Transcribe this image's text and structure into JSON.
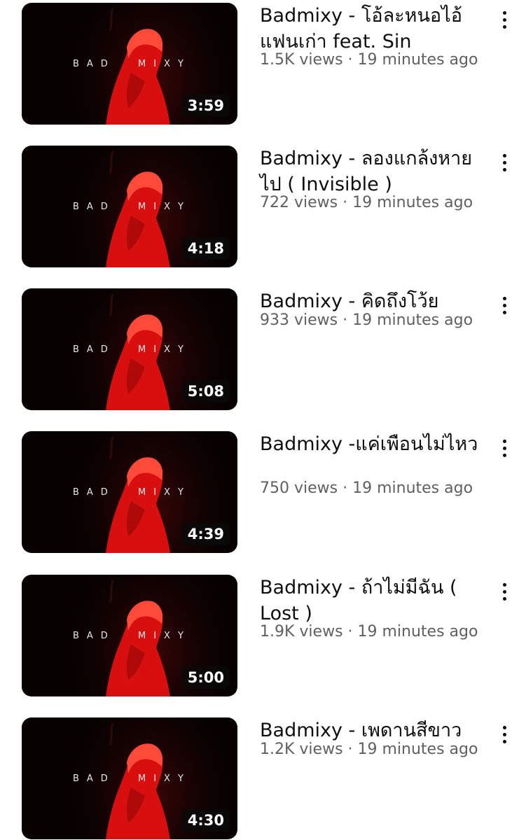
{
  "brand_text_left": "BAD",
  "brand_text_right": "MIXY",
  "videos": [
    {
      "title": "Badmixy -  โอ้ละหนอไอ้แฟนเก่า feat.  Sin",
      "views": "1.5K views",
      "age": "19 minutes ago",
      "duration": "3:59"
    },
    {
      "title": "Badmixy - ลองแกล้งหายไป ( Invisible )",
      "views": "722 views",
      "age": "19 minutes ago",
      "duration": "4:18"
    },
    {
      "title": "Badmixy - คิดถึงโว้ย",
      "views": "933 views",
      "age": "19 minutes ago",
      "duration": "5:08"
    },
    {
      "title": "Badmixy -แค่เพือนไม่ไหว",
      "views": "750 views",
      "age": "19 minutes ago",
      "duration": "4:39"
    },
    {
      "title": "Badmixy - ถ้าไม่มีฉัน ( Lost )",
      "views": "1.9K views",
      "age": "19 minutes ago",
      "duration": "5:00"
    },
    {
      "title": "Badmixy - เพดานสีขาว",
      "views": "1.2K views",
      "age": "19 minutes ago",
      "duration": "4:30"
    }
  ],
  "icons": {
    "more": "more-vert-icon"
  }
}
